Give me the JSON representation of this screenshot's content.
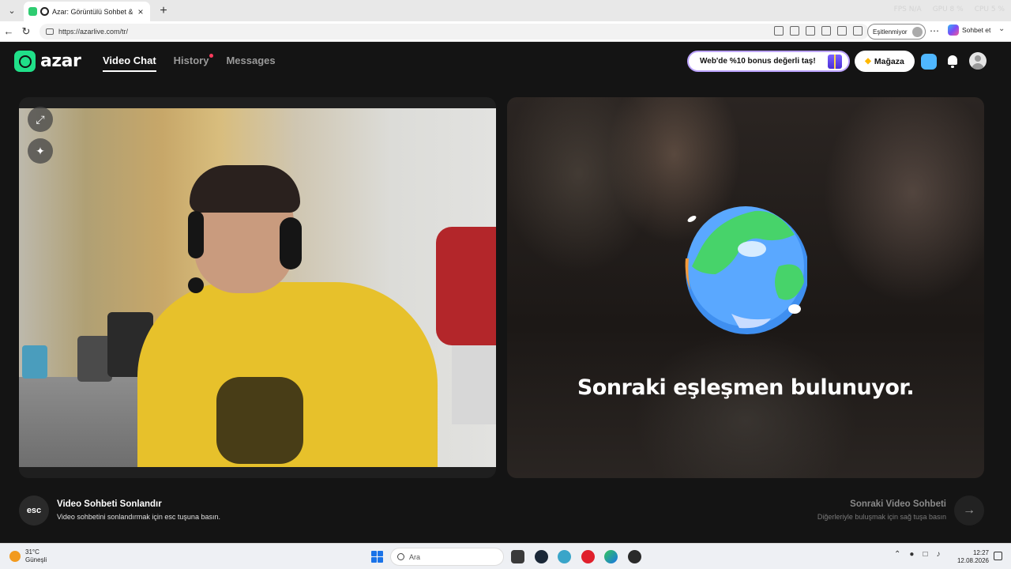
{
  "browser": {
    "tab_title": "Azar: Görüntülü Sohbet & Yeni",
    "url": "https://azarlive.com/tr/",
    "sync_status": "Eşitlenmiyor",
    "copilot_label": "Sohbet et",
    "stats": [
      "FPS N/A",
      "GPU 8 %",
      "CPU 5 %"
    ]
  },
  "app": {
    "logo_text": "azar",
    "nav": [
      "Video Chat",
      "History",
      "Messages"
    ],
    "promo_text": "Web'de %10 bonus değerli taş!",
    "store_label": "Mağaza",
    "searching_text": "Sonraki eşleşmen bulunuyor.",
    "end_key": "esc",
    "end_title": "Video Sohbeti Sonlandır",
    "end_desc": "Video sohbetini sonlandırmak için esc tuşuna basın.",
    "next_title": "Sonraki Video Sohbeti",
    "next_desc": "Diğerleriyle buluşmak için sağ tuşa basın",
    "accent_color": "#20e089"
  },
  "taskbar": {
    "temperature": "31°C",
    "weather": "Güneşli",
    "search_placeholder": "Ara",
    "time": "12:27",
    "date": "12.08.2026"
  }
}
